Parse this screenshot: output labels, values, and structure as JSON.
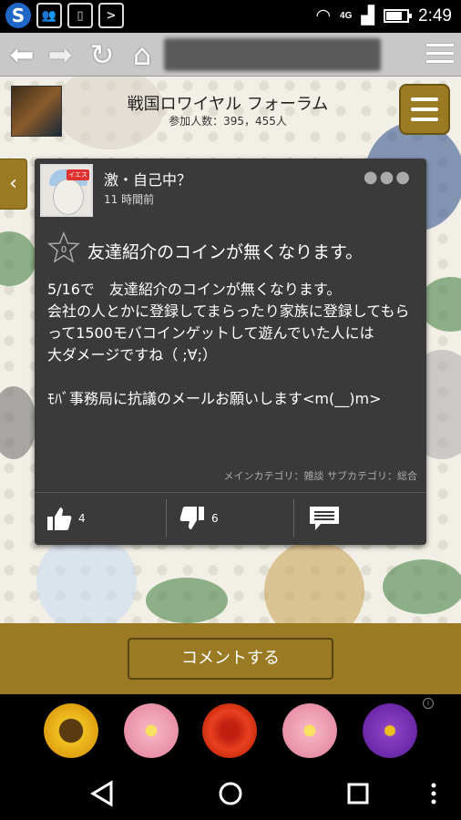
{
  "status": {
    "time": "2:49",
    "network": "4G"
  },
  "forum": {
    "title": "戦国ロワイヤル フォーラム",
    "participants": "参加人数：395，455人"
  },
  "post": {
    "author": "激・自己中？",
    "time": "11 時間前",
    "star_count": "0",
    "title": "友達紹介のコインが無くなります。",
    "body": "5/16で　友達紹介のコインが無くなります。\n会社の人とかに登録してまらったり家族に登録してもらって1500モバコインゲットして遊んでいた人には\n大ダメージですね（ ;∀;）\n\nﾓﾊﾞ事務局に抗議のメールお願いします<m(__)m>",
    "category": "メインカテゴリ：雑談 サブカテゴリ：総合",
    "likes": "4",
    "dislikes": "6",
    "avatar_tag": "イエス"
  },
  "comment_button": "コメントする",
  "colors": {
    "gold": "#9a7a22",
    "card": "#3a3a3a"
  }
}
